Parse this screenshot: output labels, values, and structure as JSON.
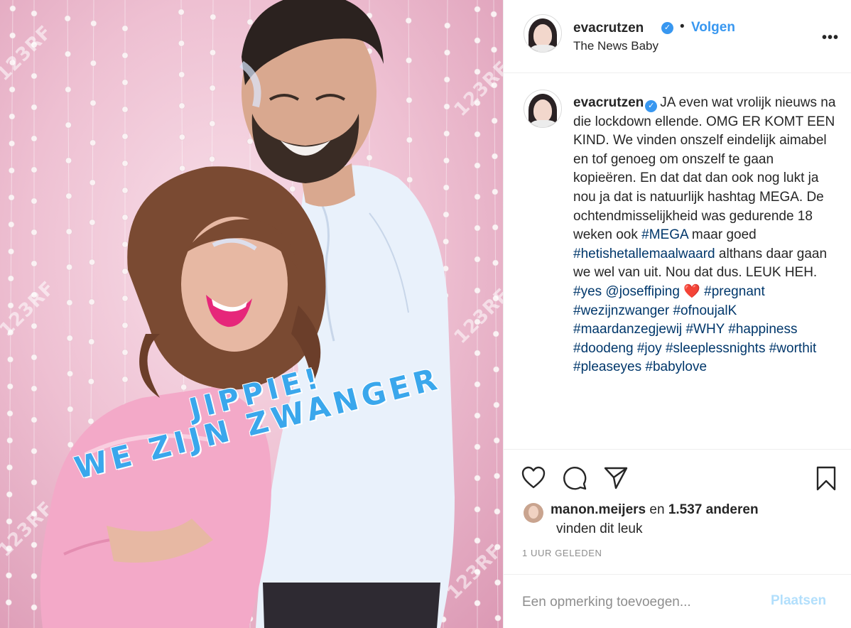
{
  "post": {
    "image_overlay": {
      "line1": "JIPPIE!",
      "line2": "WE ZIJN ZWANGER"
    },
    "watermark": "123RF"
  },
  "header": {
    "username": "evacrutzen",
    "separator": "•",
    "follow_label": "Volgen",
    "location": "The News Baby",
    "more_icon": "more-options-icon"
  },
  "caption": {
    "username": "evacrutzen",
    "segments": [
      {
        "text": "JA even wat vrolijk nieuws na die lockdown ellende. OMG ER KOMT EEN KIND. We vinden onszelf eindelijk aimabel en tof genoeg om onszelf te gaan kopieëren. En dat dat dan ook nog lukt ja nou ja dat is natuurlijk hashtag MEGA. De ochtendmisselijkheid was gedurende 18 weken ook ",
        "tag": false
      },
      {
        "text": "#MEGA",
        "tag": true
      },
      {
        "text": " maar goed ",
        "tag": false
      },
      {
        "text": "#hetishetallemaalwaard",
        "tag": true
      },
      {
        "text": " althans daar gaan we wel van uit. Nou dat dus. LEUK HEH. ",
        "tag": false
      },
      {
        "text": "#yes",
        "tag": true
      },
      {
        "text": " ",
        "tag": false
      },
      {
        "text": "@joseffiping",
        "tag": true
      },
      {
        "text": " ",
        "tag": false
      },
      {
        "text": "❤️",
        "tag": false,
        "heart": true
      },
      {
        "text": " ",
        "tag": false
      },
      {
        "text": "#pregnant",
        "tag": true
      },
      {
        "text": " ",
        "tag": false
      },
      {
        "text": "#wezijnzwanger",
        "tag": true
      },
      {
        "text": " ",
        "tag": false
      },
      {
        "text": "#ofnoujalK",
        "tag": true
      },
      {
        "text": " ",
        "tag": false
      },
      {
        "text": "#maardanzegjewij",
        "tag": true
      },
      {
        "text": " ",
        "tag": false
      },
      {
        "text": "#WHY",
        "tag": true
      },
      {
        "text": " ",
        "tag": false
      },
      {
        "text": "#happiness",
        "tag": true
      },
      {
        "text": " ",
        "tag": false
      },
      {
        "text": "#doodeng",
        "tag": true
      },
      {
        "text": " ",
        "tag": false
      },
      {
        "text": "#joy",
        "tag": true
      },
      {
        "text": " ",
        "tag": false
      },
      {
        "text": "#sleeplessnights",
        "tag": true
      },
      {
        "text": " ",
        "tag": false
      },
      {
        "text": "#worthit",
        "tag": true
      },
      {
        "text": " ",
        "tag": false
      },
      {
        "text": "#pleaseyes",
        "tag": true
      },
      {
        "text": " ",
        "tag": false
      },
      {
        "text": "#babylove",
        "tag": true
      }
    ]
  },
  "actions": {
    "icons": [
      "like-heart-icon",
      "comment-icon",
      "share-icon",
      "save-bookmark-icon"
    ]
  },
  "likes": {
    "liked_by": "manon.meijers",
    "middle": " en ",
    "others": "1.537 anderen",
    "line2": "vinden dit leuk"
  },
  "timestamp": "1 UUR GELEDEN",
  "comment": {
    "placeholder": "Een opmerking toevoegen...",
    "post_label": "Plaatsen"
  },
  "colors": {
    "accent": "#3897f0",
    "hashtag": "#00376b",
    "post_disabled": "#b2dffc",
    "overlay_text": "#3aa7ec",
    "photo_background": "#efbfd1"
  }
}
